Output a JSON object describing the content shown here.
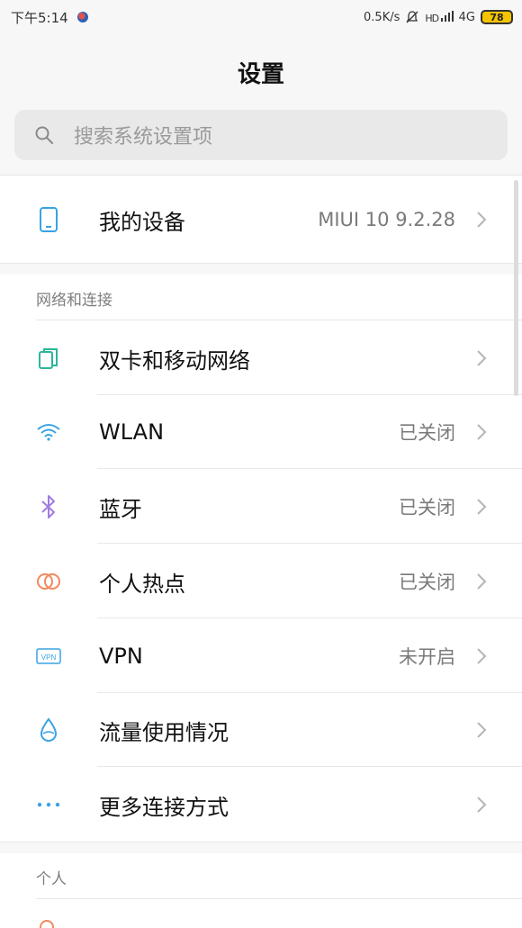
{
  "status_bar": {
    "time": "下午5:14",
    "net_speed": "0.5K/s",
    "hd_label": "HD",
    "network": "4G",
    "battery": "78"
  },
  "header": {
    "title": "设置"
  },
  "search": {
    "placeholder": "搜索系统设置项"
  },
  "device": {
    "label": "我的设备",
    "value": "MIUI 10 9.2.28"
  },
  "sections": {
    "network": {
      "title": "网络和连接",
      "items": [
        {
          "label": "双卡和移动网络",
          "value": ""
        },
        {
          "label": "WLAN",
          "value": "已关闭"
        },
        {
          "label": "蓝牙",
          "value": "已关闭"
        },
        {
          "label": "个人热点",
          "value": "已关闭"
        },
        {
          "label": "VPN",
          "value": "未开启"
        },
        {
          "label": "流量使用情况",
          "value": ""
        },
        {
          "label": "更多连接方式",
          "value": ""
        }
      ]
    },
    "personal": {
      "title": "个人"
    }
  },
  "colors": {
    "accent_blue": "#3aa3e3",
    "teal": "#2bb59a",
    "purple": "#a07ce0",
    "orange": "#f08a5d"
  }
}
